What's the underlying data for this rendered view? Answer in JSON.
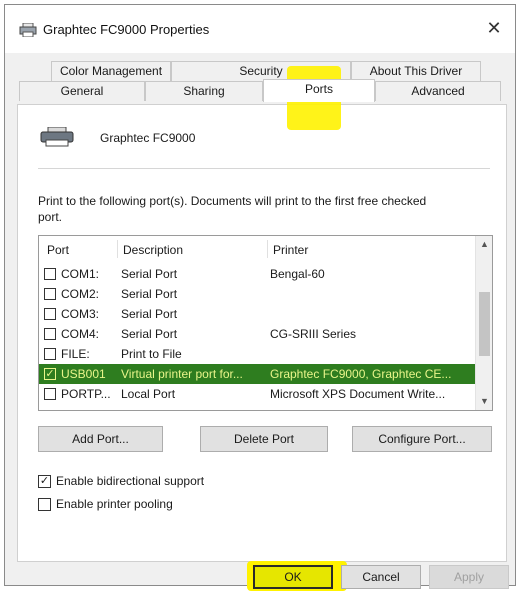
{
  "window": {
    "title": "Graphtec FC9000 Properties",
    "close_label": "✕"
  },
  "tabs": {
    "row1": [
      {
        "label": "Color Management"
      },
      {
        "label": "Security"
      },
      {
        "label": "About This Driver"
      }
    ],
    "row2": [
      {
        "label": "General"
      },
      {
        "label": "Sharing"
      },
      {
        "label": "Ports"
      },
      {
        "label": "Advanced"
      }
    ],
    "active": "Ports"
  },
  "printer": {
    "name": "Graphtec FC9000"
  },
  "instructions": "Print to the following port(s). Documents will print to the first free checked port.",
  "port_table": {
    "headers": [
      "Port",
      "Description",
      "Printer"
    ],
    "rows": [
      {
        "port": "COM1:",
        "description": "Serial Port",
        "printer": "Bengal-60",
        "checked": false,
        "check_mark": ""
      },
      {
        "port": "COM2:",
        "description": "Serial Port",
        "printer": "",
        "checked": false,
        "check_mark": ""
      },
      {
        "port": "COM3:",
        "description": "Serial Port",
        "printer": "",
        "checked": false,
        "check_mark": ""
      },
      {
        "port": "COM4:",
        "description": "Serial Port",
        "printer": "CG-SRIII Series",
        "checked": false,
        "check_mark": ""
      },
      {
        "port": "FILE:",
        "description": "Print to File",
        "printer": "",
        "checked": false,
        "check_mark": ""
      },
      {
        "port": "USB001",
        "description": "Virtual printer port for...",
        "printer": "Graphtec FC9000, Graphtec CE...",
        "checked": true,
        "check_mark": "✓",
        "selected": true
      },
      {
        "port": "PORTP...",
        "description": "Local Port",
        "printer": "Microsoft XPS Document Write...",
        "checked": false,
        "check_mark": ""
      }
    ],
    "scroll_up": "▲",
    "scroll_down": "▼"
  },
  "port_buttons": {
    "add": "Add Port...",
    "delete": "Delete Port",
    "configure": "Configure Port..."
  },
  "options": {
    "bidirectional": {
      "label": "Enable bidirectional support",
      "checked": true,
      "check_mark": "✓"
    },
    "pooling": {
      "label": "Enable printer pooling",
      "checked": false,
      "check_mark": ""
    }
  },
  "footer": {
    "ok": "OK",
    "cancel": "Cancel",
    "apply": "Apply"
  },
  "colors": {
    "highlight": "#fff200",
    "selected_row": "#2e7d1f",
    "selected_text": "#e9f58a"
  }
}
